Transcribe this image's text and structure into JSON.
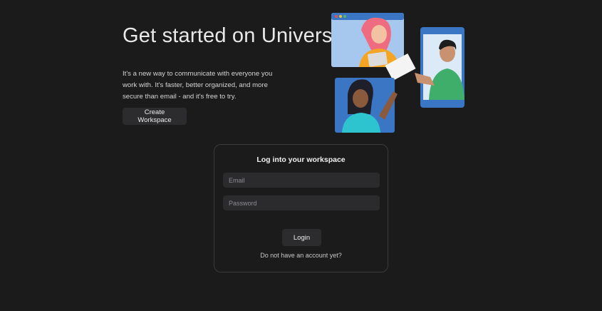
{
  "hero": {
    "title": "Get started on Universe",
    "description": "It's a new way to communicate with everyone you work with. It's faster, better organized, and more secure than email - and it's free to try.",
    "create_button": "Create Workspace"
  },
  "login": {
    "title": "Log into your workspace",
    "email_placeholder": "Email",
    "password_placeholder": "Password",
    "login_button": "Login",
    "signup_link": "Do not have an account yet?"
  },
  "colors": {
    "background": "#1b1b1c",
    "panel_blue": "#3b76c4",
    "button": "#2c2c2e"
  },
  "illustration": {
    "subject": "people-video-call-illustration",
    "dots": [
      "#e05353",
      "#e8c23b",
      "#4cbb6a"
    ]
  }
}
